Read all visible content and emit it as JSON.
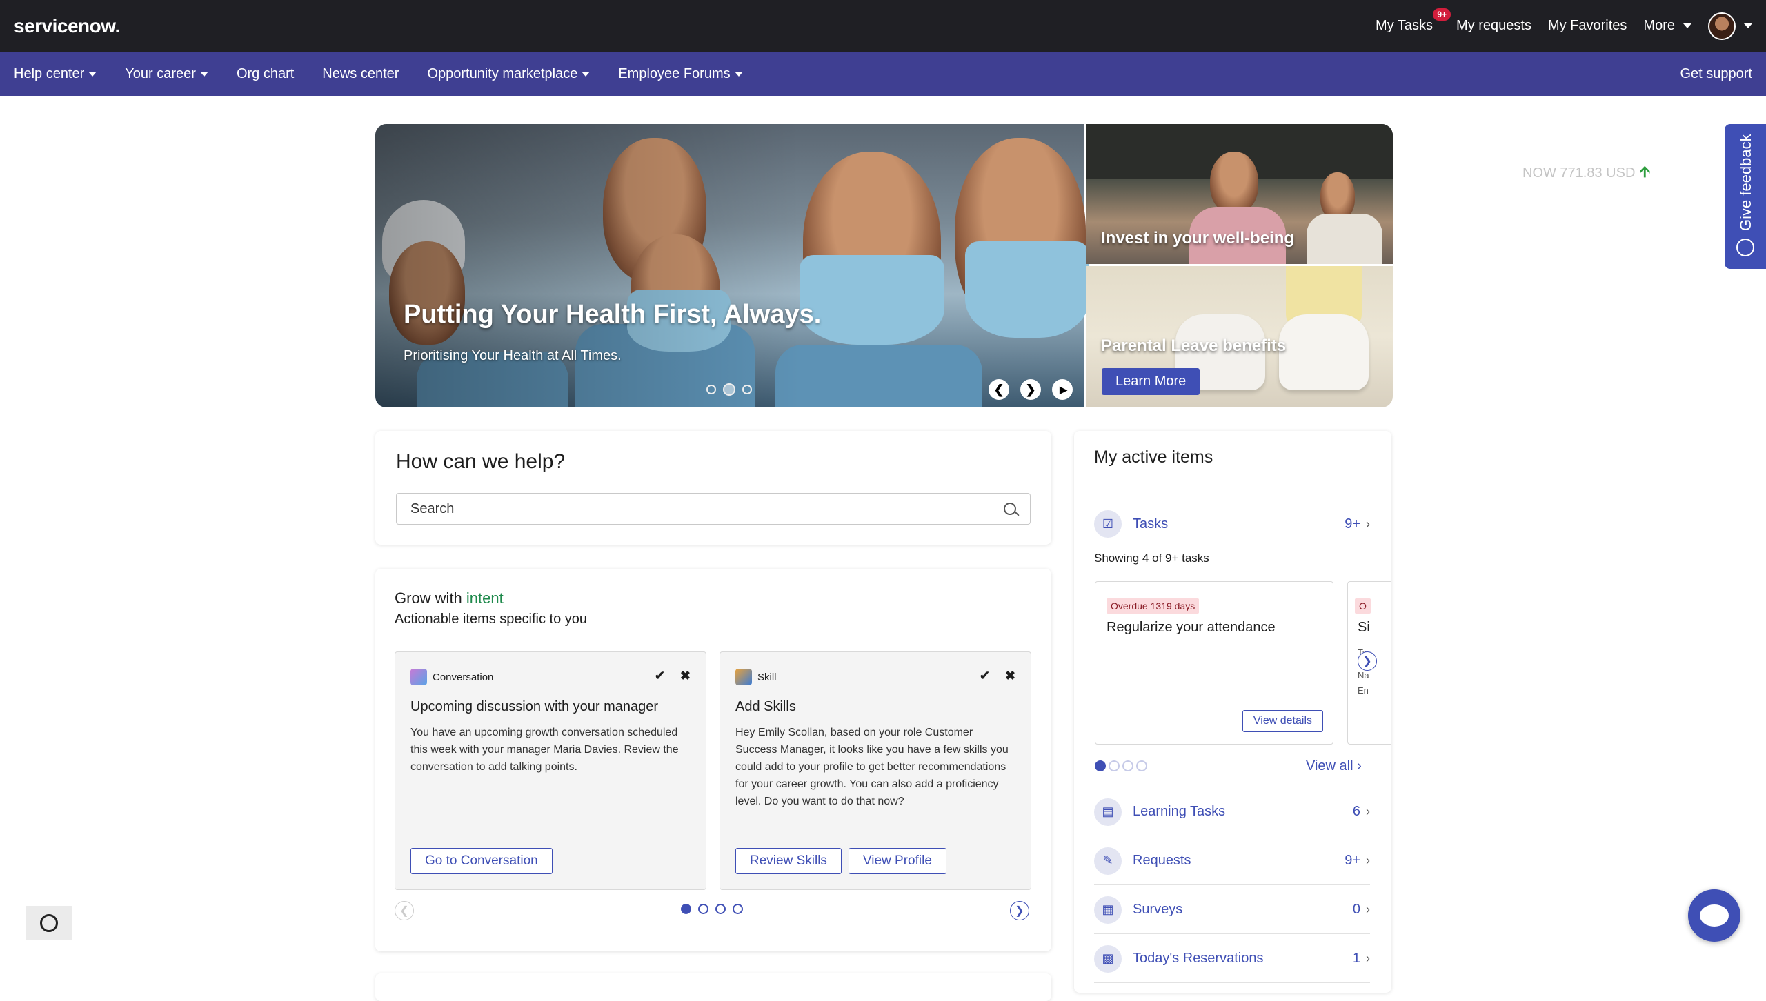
{
  "topbar": {
    "logo": "servicenow.",
    "my_tasks": "My Tasks",
    "tasks_badge": "9+",
    "my_requests": "My requests",
    "my_favorites": "My Favorites",
    "more": "More"
  },
  "nav": {
    "items": [
      "Help center",
      "Your career",
      "Org chart",
      "News center",
      "Opportunity marketplace",
      "Employee Forums"
    ],
    "get_support": "Get support"
  },
  "hero": {
    "title": "Putting Your Health First, Always.",
    "subtitle": "Prioritising Your Health at All Times.",
    "tile1_title": "Invest in your well-being",
    "tile2_title": "Parental Leave benefits",
    "learn_more": "Learn More"
  },
  "stock": {
    "text": "NOW 771.83 USD",
    "icon": "arrow-up-icon",
    "color": "#2e9e3e"
  },
  "feedback": {
    "label": "Give feedback"
  },
  "help": {
    "title": "How can we help?",
    "search_placeholder": "Search"
  },
  "grow": {
    "title_prefix": "Grow with",
    "title_highlight": "intent",
    "subtitle": "Actionable items specific to you",
    "cards": [
      {
        "type": "Conversation",
        "title": "Upcoming discussion with your manager",
        "body": "You have an upcoming growth conversation scheduled this week with your manager Maria Davies. Review the conversation to add talking points.",
        "buttons": [
          "Go to Conversation"
        ]
      },
      {
        "type": "Skill",
        "title": "Add Skills",
        "body": "Hey Emily Scollan, based on your role Customer Success Manager, it looks like you have a few skills you could add to your profile to get better recommendations for your career growth. You can also add a proficiency level. Do you want to do that now?",
        "buttons": [
          "Review Skills",
          "View Profile"
        ]
      }
    ]
  },
  "active": {
    "title": "My active items",
    "tasks": {
      "label": "Tasks",
      "count": "9+"
    },
    "showing": "Showing 4 of 9+ tasks",
    "task_card": {
      "badge": "Overdue 1319 days",
      "title": "Regularize your attendance",
      "button": "View details"
    },
    "task_card2": {
      "badge": "O",
      "title": "Si",
      "l1": "Ta",
      "l2": "Na",
      "l3": "En"
    },
    "view_all": "View all",
    "rows": [
      {
        "label": "Learning Tasks",
        "count": "6"
      },
      {
        "label": "Requests",
        "count": "9+"
      },
      {
        "label": "Surveys",
        "count": "0"
      },
      {
        "label": "Today's Reservations",
        "count": "1"
      }
    ]
  },
  "colors": {
    "brand": "#3f3f92",
    "accent": "#3f4fb5",
    "topbar": "#1f1f24"
  }
}
